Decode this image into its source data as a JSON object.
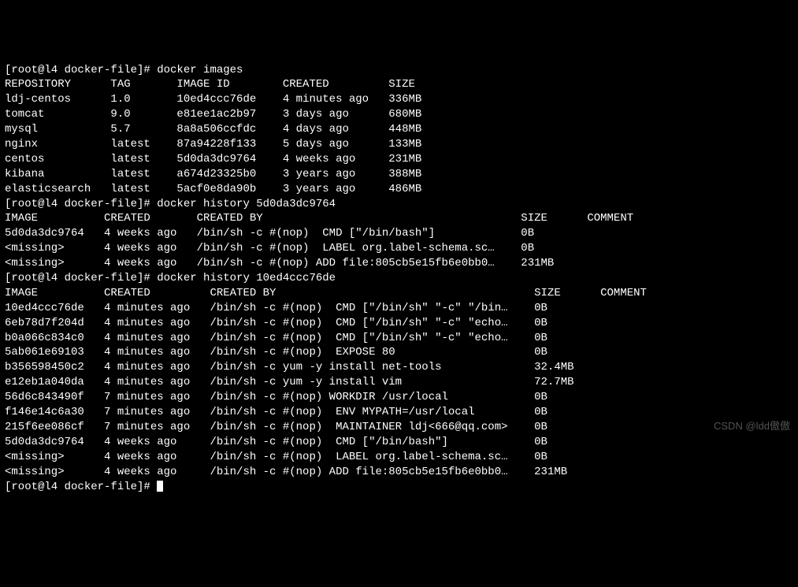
{
  "prompt_prefix": "[root@l4 docker-file]# ",
  "commands": {
    "images": "docker images",
    "history1": "docker history 5d0da3dc9764",
    "history2": "docker history 10ed4ccc76de"
  },
  "images_header": {
    "repository": "REPOSITORY",
    "tag": "TAG",
    "image_id": "IMAGE ID",
    "created": "CREATED",
    "size": "SIZE"
  },
  "images_rows": [
    {
      "repository": "ldj-centos",
      "tag": "1.0",
      "image_id": "10ed4ccc76de",
      "created": "4 minutes ago",
      "size": "336MB"
    },
    {
      "repository": "tomcat",
      "tag": "9.0",
      "image_id": "e81ee1ac2b97",
      "created": "3 days ago",
      "size": "680MB"
    },
    {
      "repository": "mysql",
      "tag": "5.7",
      "image_id": "8a8a506ccfdc",
      "created": "4 days ago",
      "size": "448MB"
    },
    {
      "repository": "nginx",
      "tag": "latest",
      "image_id": "87a94228f133",
      "created": "5 days ago",
      "size": "133MB"
    },
    {
      "repository": "centos",
      "tag": "latest",
      "image_id": "5d0da3dc9764",
      "created": "4 weeks ago",
      "size": "231MB"
    },
    {
      "repository": "kibana",
      "tag": "latest",
      "image_id": "a674d23325b0",
      "created": "3 years ago",
      "size": "388MB"
    },
    {
      "repository": "elasticsearch",
      "tag": "latest",
      "image_id": "5acf0e8da90b",
      "created": "3 years ago",
      "size": "486MB"
    }
  ],
  "history_header": {
    "image": "IMAGE",
    "created": "CREATED",
    "created_by": "CREATED BY",
    "size": "SIZE",
    "comment": "COMMENT"
  },
  "history1_rows": [
    {
      "image": "5d0da3dc9764",
      "created": "4 weeks ago",
      "created_by": "/bin/sh -c #(nop)  CMD [\"/bin/bash\"]",
      "size": "0B",
      "comment": ""
    },
    {
      "image": "<missing>",
      "created": "4 weeks ago",
      "created_by": "/bin/sh -c #(nop)  LABEL org.label-schema.sc…",
      "size": "0B",
      "comment": ""
    },
    {
      "image": "<missing>",
      "created": "4 weeks ago",
      "created_by": "/bin/sh -c #(nop) ADD file:805cb5e15fb6e0bb0…",
      "size": "231MB",
      "comment": ""
    }
  ],
  "history2_rows": [
    {
      "image": "10ed4ccc76de",
      "created": "4 minutes ago",
      "created_by": "/bin/sh -c #(nop)  CMD [\"/bin/sh\" \"-c\" \"/bin…",
      "size": "0B",
      "comment": ""
    },
    {
      "image": "6eb78d7f204d",
      "created": "4 minutes ago",
      "created_by": "/bin/sh -c #(nop)  CMD [\"/bin/sh\" \"-c\" \"echo…",
      "size": "0B",
      "comment": ""
    },
    {
      "image": "b0a066c834c0",
      "created": "4 minutes ago",
      "created_by": "/bin/sh -c #(nop)  CMD [\"/bin/sh\" \"-c\" \"echo…",
      "size": "0B",
      "comment": ""
    },
    {
      "image": "5ab061e69103",
      "created": "4 minutes ago",
      "created_by": "/bin/sh -c #(nop)  EXPOSE 80",
      "size": "0B",
      "comment": ""
    },
    {
      "image": "b356598450c2",
      "created": "4 minutes ago",
      "created_by": "/bin/sh -c yum -y install net-tools",
      "size": "32.4MB",
      "comment": ""
    },
    {
      "image": "e12eb1a040da",
      "created": "4 minutes ago",
      "created_by": "/bin/sh -c yum -y install vim",
      "size": "72.7MB",
      "comment": ""
    },
    {
      "image": "56d6c843490f",
      "created": "7 minutes ago",
      "created_by": "/bin/sh -c #(nop) WORKDIR /usr/local",
      "size": "0B",
      "comment": ""
    },
    {
      "image": "f146e14c6a30",
      "created": "7 minutes ago",
      "created_by": "/bin/sh -c #(nop)  ENV MYPATH=/usr/local",
      "size": "0B",
      "comment": ""
    },
    {
      "image": "215f6ee086cf",
      "created": "7 minutes ago",
      "created_by": "/bin/sh -c #(nop)  MAINTAINER ldj<666@qq.com>",
      "size": "0B",
      "comment": ""
    },
    {
      "image": "5d0da3dc9764",
      "created": "4 weeks ago",
      "created_by": "/bin/sh -c #(nop)  CMD [\"/bin/bash\"]",
      "size": "0B",
      "comment": ""
    },
    {
      "image": "<missing>",
      "created": "4 weeks ago",
      "created_by": "/bin/sh -c #(nop)  LABEL org.label-schema.sc…",
      "size": "0B",
      "comment": ""
    },
    {
      "image": "<missing>",
      "created": "4 weeks ago",
      "created_by": "/bin/sh -c #(nop) ADD file:805cb5e15fb6e0bb0…",
      "size": "231MB",
      "comment": ""
    }
  ],
  "watermark": "CSDN @ldd傲傲"
}
